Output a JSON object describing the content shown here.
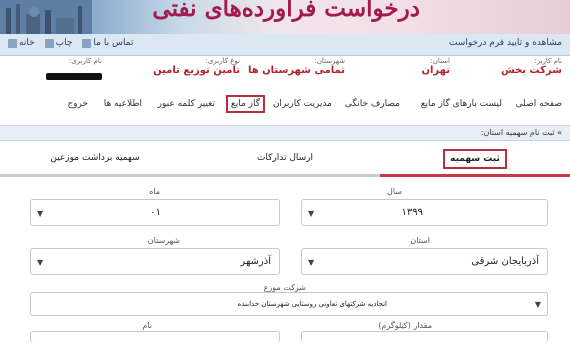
{
  "banner": {
    "title": "درخواست فرآورده‌های نفتی"
  },
  "menubar": {
    "crumb": "مشاهده و تایید فرم درخواست",
    "links": [
      {
        "label": "خانه",
        "icon": "home-icon"
      },
      {
        "label": "چاپ",
        "icon": "print-icon"
      },
      {
        "label": "تماس با ما",
        "icon": "contact-icon"
      }
    ]
  },
  "info": {
    "customer_name_label": "نام کاربر:",
    "customer_name": "شرکت بخش",
    "province_label": "استان:",
    "province": "تهران",
    "city_label": "شهرستان:",
    "city": "تمامی شهرستان ها",
    "user_type_label": "نوع کاربری:",
    "user_type": "تامین توزیع تامین",
    "username_label": "نام کاربری:"
  },
  "nav": [
    {
      "label": "صفحه اصلی",
      "highlight": false
    },
    {
      "label": "لیست بارهای گاز مایع",
      "highlight": false
    },
    {
      "label": "مصارف خانگی",
      "highlight": false
    },
    {
      "label": "مدیریت کاربران",
      "highlight": false
    },
    {
      "label": "گاز مایع",
      "highlight": true
    },
    {
      "label": "تغییر کلمه عبور",
      "highlight": false
    },
    {
      "label": "اطلاعیه ها",
      "highlight": false
    },
    {
      "label": "خروج",
      "highlight": false
    }
  ],
  "section": {
    "title": "» ثبت نام سهمیه استان:"
  },
  "tabs": [
    {
      "label": "ثبت سهمیه",
      "active": true
    },
    {
      "label": "ارسال تدارکات",
      "active": false
    },
    {
      "label": "سهمیه برداشت موزعین",
      "active": false
    }
  ],
  "form": {
    "year_label": "سال",
    "year": "۱۳۹۹",
    "month_label": "ماه",
    "month": "۰۱",
    "province_label": "استان",
    "province": "آذربایجان شرقی",
    "city_label": "شهرستان",
    "city": "آذرشهر",
    "distributor_label": "شرکت موزع",
    "distributor": "اتحادیه شرکتهای تعاونی روستایی شهرستان خدابنده",
    "amount_label": "مقدار (کیلوگرم)",
    "name_label": "نام"
  },
  "colors": {
    "accent": "#b3303d",
    "title": "#a51a4e",
    "menubar": "#dce7f4"
  }
}
